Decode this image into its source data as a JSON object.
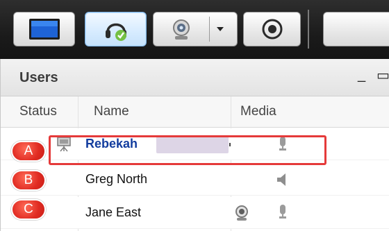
{
  "toolbar": {
    "buttons": [
      {
        "icon": "screen-share-icon"
      },
      {
        "icon": "headset-icon",
        "active": true
      },
      {
        "icon": "webcam-icon"
      },
      {
        "icon": "chevron-down-icon"
      },
      {
        "icon": "record-icon"
      }
    ]
  },
  "panel": {
    "title": "Users",
    "minimize": "_",
    "maximize": "▭"
  },
  "columns": {
    "status": "Status",
    "name": "Name",
    "media": "Media"
  },
  "users": [
    {
      "badge": "A",
      "name": "Rebekah",
      "presenter": true,
      "media": [
        "microphone-icon"
      ]
    },
    {
      "badge": "B",
      "name": "Greg North",
      "presenter": false,
      "media": [
        "speaker-icon"
      ]
    },
    {
      "badge": "C",
      "name": "Jane East",
      "presenter": false,
      "media": [
        "webcam-icon",
        "microphone-icon"
      ]
    }
  ],
  "colors": {
    "toolbar_bg": "#1b1b1b",
    "active_button": "#d8ecff",
    "highlight": "#e53a3a",
    "badge": "#e02b22",
    "presenter_name": "#123c9e"
  }
}
